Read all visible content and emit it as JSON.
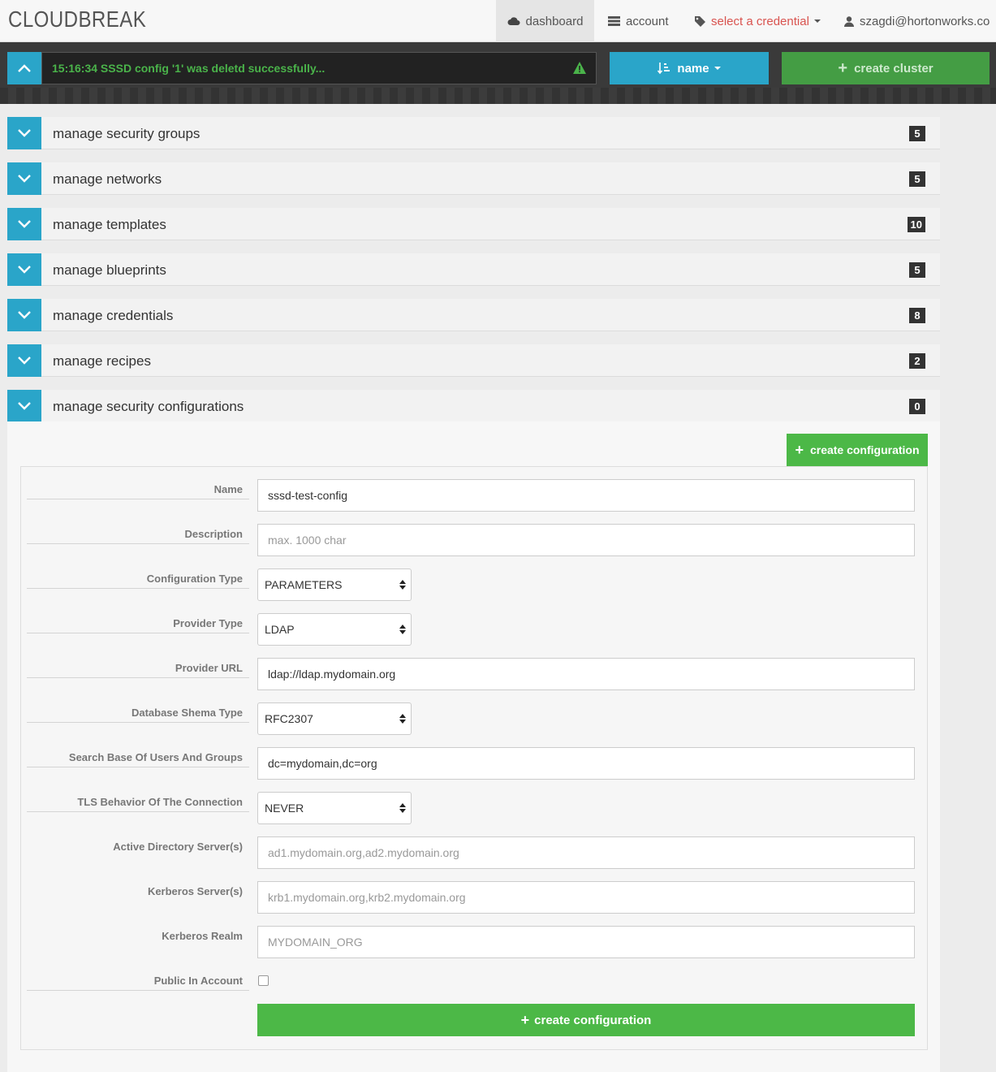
{
  "nav": {
    "brand": "CLOUDBREAK",
    "dashboard": "dashboard",
    "account": "account",
    "credential": "select a credential",
    "user": "szagdi@hortonworks.com"
  },
  "toolbar": {
    "notification": "15:16:34 SSSD config '1' was deletd successfully...",
    "sort_label": "name",
    "create_cluster": "create cluster"
  },
  "panels": [
    {
      "title": "manage security groups",
      "count": "5"
    },
    {
      "title": "manage networks",
      "count": "5"
    },
    {
      "title": "manage templates",
      "count": "10"
    },
    {
      "title": "manage blueprints",
      "count": "5"
    },
    {
      "title": "manage credentials",
      "count": "8"
    },
    {
      "title": "manage recipes",
      "count": "2"
    },
    {
      "title": "manage security configurations",
      "count": "0"
    }
  ],
  "form": {
    "create_button_top": "create configuration",
    "fields": {
      "name": {
        "label": "Name",
        "value": "sssd-test-config"
      },
      "description": {
        "label": "Description",
        "placeholder": "max. 1000 char"
      },
      "config_type": {
        "label": "Configuration Type",
        "value": "PARAMETERS"
      },
      "provider_type": {
        "label": "Provider Type",
        "value": "LDAP"
      },
      "provider_url": {
        "label": "Provider URL",
        "value": "ldap://ldap.mydomain.org"
      },
      "schema_type": {
        "label": "Database Shema Type",
        "value": "RFC2307"
      },
      "search_base": {
        "label": "Search Base Of Users And Groups",
        "value": "dc=mydomain,dc=org"
      },
      "tls": {
        "label": "TLS Behavior Of The Connection",
        "value": "NEVER"
      },
      "ad_servers": {
        "label": "Active Directory Server(s)",
        "placeholder": "ad1.mydomain.org,ad2.mydomain.org"
      },
      "kerberos_servers": {
        "label": "Kerberos Server(s)",
        "placeholder": "krb1.mydomain.org,krb2.mydomain.org"
      },
      "kerberos_realm": {
        "label": "Kerberos Realm",
        "placeholder": "MYDOMAIN_ORG"
      },
      "public": {
        "label": "Public In Account",
        "checked": false
      }
    },
    "submit": "create configuration"
  },
  "colors": {
    "accent_blue": "#2aa5c9",
    "success_green": "#4cb847",
    "dark_green": "#449d44",
    "alert_red": "#d9534f",
    "toolbar_dark": "#3a3a3a"
  }
}
